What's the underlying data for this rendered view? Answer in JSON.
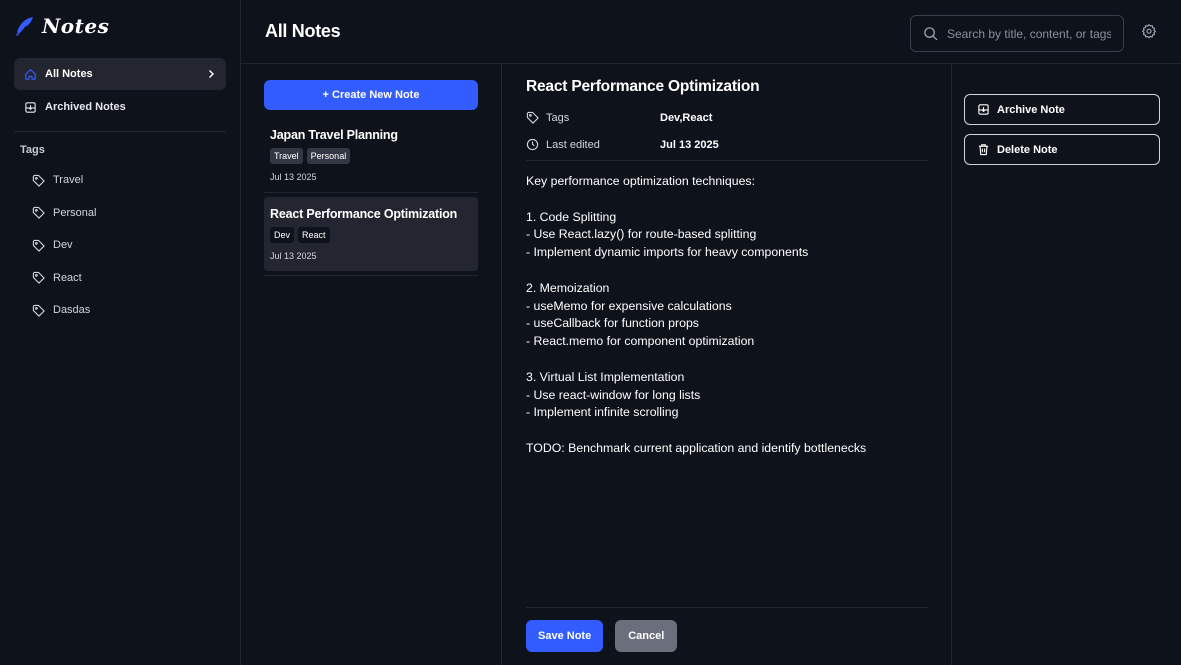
{
  "app": {
    "name": "Notes"
  },
  "sidebar": {
    "nav": [
      {
        "label": "All Notes",
        "icon": "home-icon",
        "active": true
      },
      {
        "label": "Archived Notes",
        "icon": "archive-icon",
        "active": false
      }
    ],
    "tags_heading": "Tags",
    "tags": [
      "Travel",
      "Personal",
      "Dev",
      "React",
      "Dasdas"
    ]
  },
  "header": {
    "title": "All Notes",
    "search_placeholder": "Search by title, content, or tags..."
  },
  "notes_list": {
    "create_label": "+ Create New Note",
    "notes": [
      {
        "title": "Japan Travel Planning",
        "tags": [
          "Travel",
          "Personal"
        ],
        "date": "Jul 13 2025",
        "selected": false
      },
      {
        "title": "React Performance Optimization",
        "tags": [
          "Dev",
          "React"
        ],
        "date": "Jul 13 2025",
        "selected": true
      }
    ]
  },
  "editor": {
    "title": "React Performance Optimization",
    "tags_label": "Tags",
    "tags_value": "Dev,React",
    "edited_label": "Last edited",
    "edited_value": "Jul 13 2025",
    "content_lines": [
      "Key performance optimization techniques:",
      "",
      "1. Code Splitting",
      "- Use React.lazy() for route-based splitting",
      "- Implement dynamic imports for heavy components",
      "",
      "2. Memoization",
      "- useMemo for expensive calculations",
      "- useCallback for function props",
      "- React.memo for component optimization",
      "",
      "3. Virtual List Implementation",
      "- Use react-window for long lists",
      "- Implement infinite scrolling",
      "",
      "TODO: Benchmark current application and identify bottlenecks"
    ],
    "save_label": "Save Note",
    "cancel_label": "Cancel"
  },
  "actions": {
    "archive_label": "Archive Note",
    "delete_label": "Delete Note"
  },
  "colors": {
    "background": "#0e121b",
    "accent": "#335cff",
    "surface": "#232530",
    "muted_button": "#6b6f7d"
  }
}
